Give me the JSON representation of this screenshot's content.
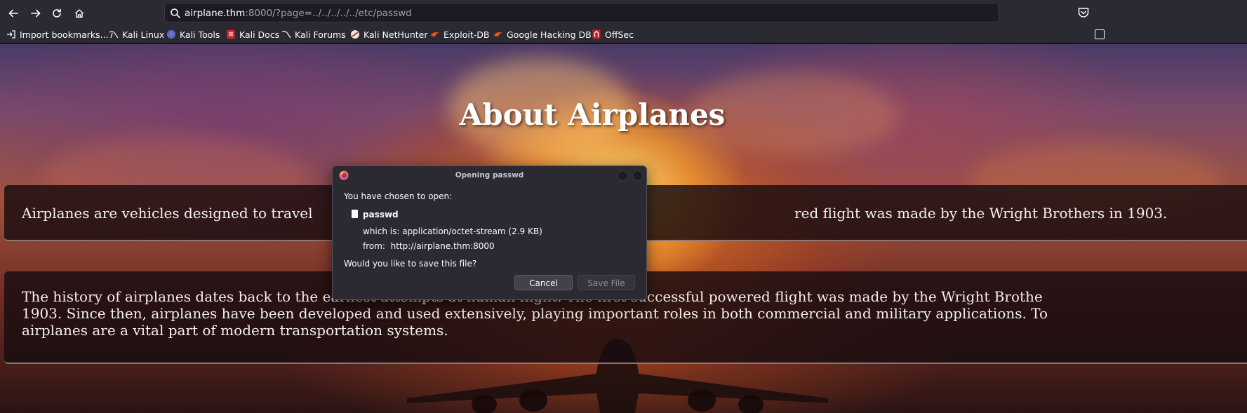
{
  "browser": {
    "url_host": "airplane.thm",
    "url_rest": ":8000/?page=../../../../../etc/passwd",
    "bookmarks": [
      {
        "label": "Import bookmarks...",
        "icon": "import-icon"
      },
      {
        "label": "Kali Linux",
        "icon": "kali-dragon-icon"
      },
      {
        "label": "Kali Tools",
        "icon": "kali-tools-icon"
      },
      {
        "label": "Kali Docs",
        "icon": "kali-docs-icon"
      },
      {
        "label": "Kali Forums",
        "icon": "kali-forums-icon"
      },
      {
        "label": "Kali NetHunter",
        "icon": "nethunter-icon"
      },
      {
        "label": "Exploit-DB",
        "icon": "exploit-db-icon"
      },
      {
        "label": "Google Hacking DB",
        "icon": "ghdb-icon"
      },
      {
        "label": "OffSec",
        "icon": "offsec-icon"
      }
    ]
  },
  "page": {
    "title": "About Airplanes",
    "paragraph1": "Airplanes are vehicles designed to travel                                                                                                            red flight was made by the Wright Brothers in 1903.",
    "paragraph2_lines": [
      "The history of airplanes dates back to the earliest attempts at human flight. The first successful powered flight was made by the Wright Brothe",
      "1903. Since then, airplanes have been developed and used extensively, playing important roles in both commercial and military applications. To",
      "airplanes are a vital part of modern transportation systems."
    ]
  },
  "dialog": {
    "title": "Opening passwd",
    "intro": "You have chosen to open:",
    "filename": "passwd",
    "which_is": "which is: application/octet-stream (2.9 KB)",
    "from": "from:  http://airplane.thm:8000",
    "question": "Would you like to save this file?",
    "cancel_label": "Cancel",
    "save_label": "Save File"
  },
  "colors": {
    "chrome_bg": "#2b2a33",
    "urlbar_bg": "#1c1b22",
    "dialog_bg": "#2b2a33",
    "text": "#fbfbfe"
  }
}
